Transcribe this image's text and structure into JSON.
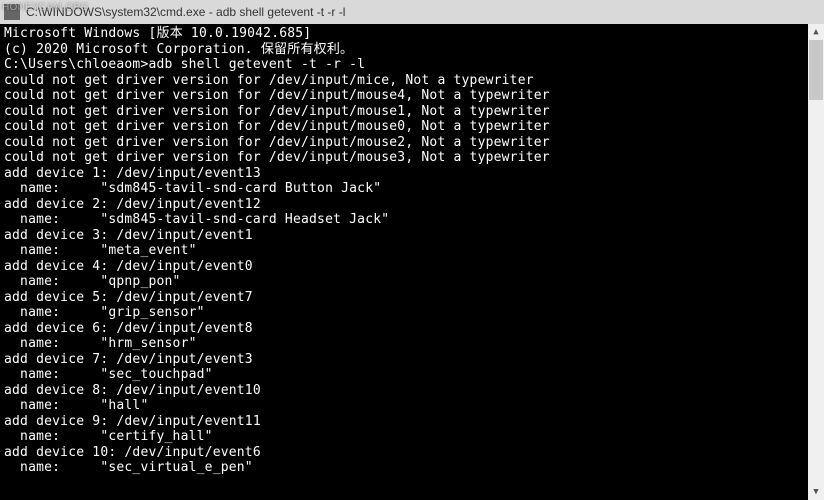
{
  "watermark": "HONEYCAM.ORG",
  "titlebar": {
    "text": "C:\\WINDOWS\\system32\\cmd.exe - adb  shell getevent -t -r -l"
  },
  "lines": {
    "l0": "Microsoft Windows [版本 10.0.19042.685]",
    "l1": "(c) 2020 Microsoft Corporation. 保留所有权利。",
    "l2": "",
    "l3": "C:\\Users\\chloeaom>adb shell getevent -t -r -l",
    "l4": "could not get driver version for /dev/input/mice, Not a typewriter",
    "l5": "could not get driver version for /dev/input/mouse4, Not a typewriter",
    "l6": "could not get driver version for /dev/input/mouse1, Not a typewriter",
    "l7": "could not get driver version for /dev/input/mouse0, Not a typewriter",
    "l8": "could not get driver version for /dev/input/mouse2, Not a typewriter",
    "l9": "could not get driver version for /dev/input/mouse3, Not a typewriter",
    "l10": "add device 1: /dev/input/event13",
    "l11": "  name:     \"sdm845-tavil-snd-card Button Jack\"",
    "l12": "add device 2: /dev/input/event12",
    "l13": "  name:     \"sdm845-tavil-snd-card Headset Jack\"",
    "l14": "add device 3: /dev/input/event1",
    "l15": "  name:     \"meta_event\"",
    "l16": "add device 4: /dev/input/event0",
    "l17": "  name:     \"qpnp_pon\"",
    "l18": "add device 5: /dev/input/event7",
    "l19": "  name:     \"grip_sensor\"",
    "l20": "add device 6: /dev/input/event8",
    "l21": "  name:     \"hrm_sensor\"",
    "l22": "add device 7: /dev/input/event3",
    "l23": "  name:     \"sec_touchpad\"",
    "l24": "add device 8: /dev/input/event10",
    "l25": "  name:     \"hall\"",
    "l26": "add device 9: /dev/input/event11",
    "l27": "  name:     \"certify_hall\"",
    "l28": "add device 10: /dev/input/event6",
    "l29": "  name:     \"sec_virtual_e_pen\""
  },
  "scrollbar": {
    "up": "▲",
    "down": "▼"
  }
}
